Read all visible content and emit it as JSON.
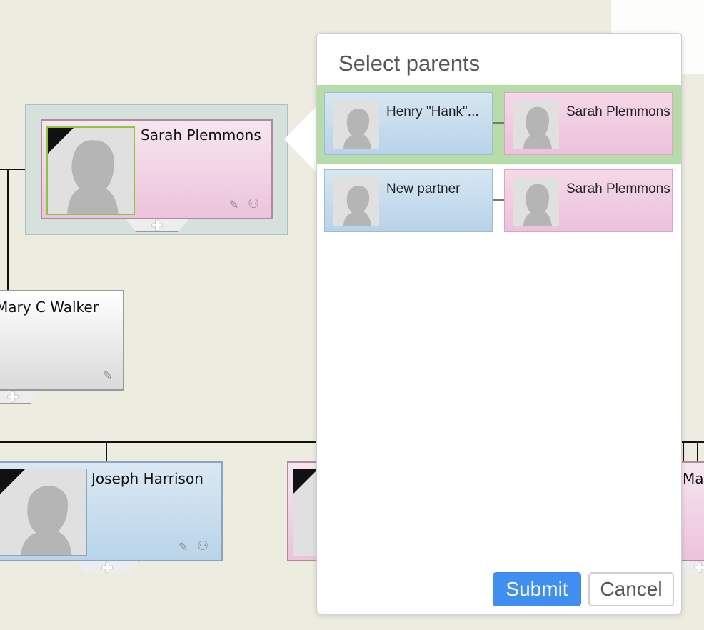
{
  "tree": {
    "focus_person": {
      "name": "Sarah Plemmons"
    },
    "person_2": {
      "name": "Mary C Walker"
    },
    "person_3": {
      "name": "Joseph Harrison"
    },
    "person_4_partial": {
      "name": "Ma"
    },
    "add_symbol": "✚",
    "edit_icon_glyph": "✎",
    "tree_icon_glyph": "⚇"
  },
  "popup": {
    "title": "Select parents",
    "options": [
      {
        "parent1": "Henry \"Hank\"...",
        "parent2": "Sarah Plemmons",
        "selected": true
      },
      {
        "parent1": "New partner",
        "parent2": "Sarah Plemmons",
        "selected": false
      }
    ],
    "submit_label": "Submit",
    "cancel_label": "Cancel"
  },
  "colors": {
    "background": "#ecece0",
    "selected_row": "#b6dcaa",
    "submit": "#3f8ef0",
    "female_card": "#ecc3dc",
    "male_card": "#b9d4ea"
  }
}
